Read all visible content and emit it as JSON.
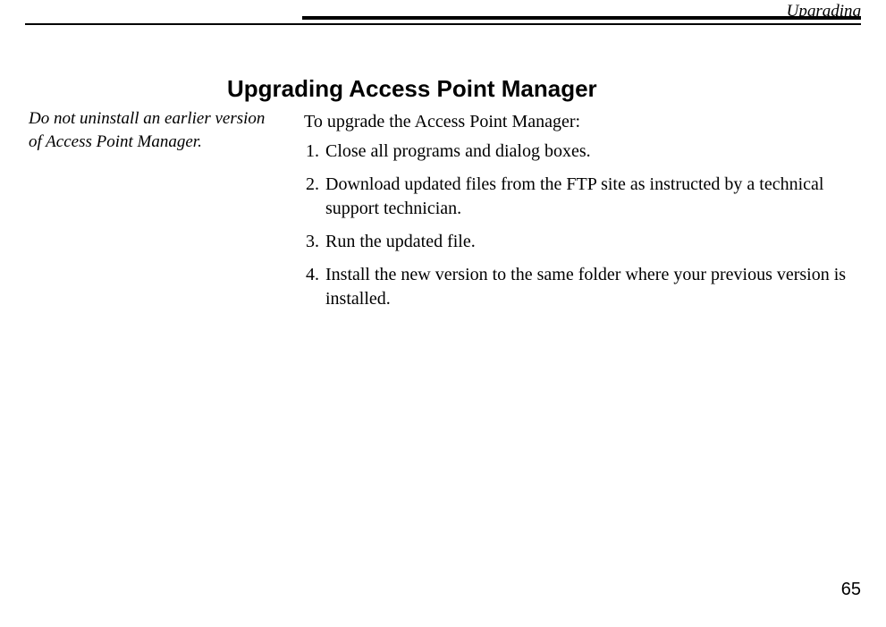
{
  "header_label": "Upgrading",
  "title": "Upgrading Access Point Manager",
  "sidebar_note": "Do not uninstall an earlier version of Access Point Manager.",
  "intro": "To upgrade the Access Point Manager:",
  "steps": [
    "Close all programs and dialog boxes.",
    "Download updated files from the FTP site as instructed by a technical support technician.",
    "Run the updated file.",
    "Install the new version to the same folder where your previous version is installed."
  ],
  "page_number": "65"
}
